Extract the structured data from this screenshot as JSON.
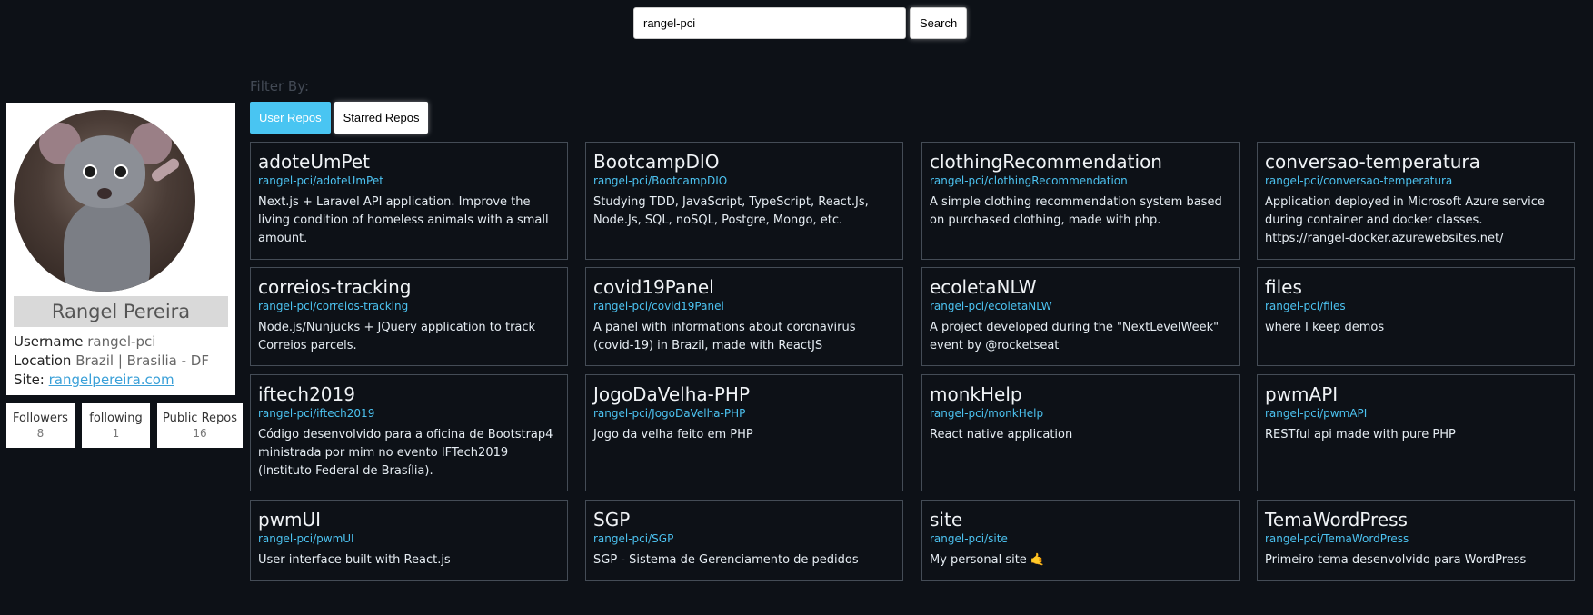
{
  "search": {
    "value": "rangel-pci",
    "button_label": "Search"
  },
  "profile": {
    "name": "Rangel Pereira",
    "username_label": "Username",
    "username": "rangel-pci",
    "location_label": "Location",
    "location": "Brazil | Brasilia - DF",
    "site_label": "Site:",
    "site": "rangelpereira.com"
  },
  "stats": [
    {
      "label": "Followers",
      "value": "8"
    },
    {
      "label": "following",
      "value": "1"
    },
    {
      "label": "Public Repos",
      "value": "16"
    }
  ],
  "filter": {
    "label": "Filter By:",
    "options": [
      "User Repos",
      "Starred Repos"
    ],
    "active": "User Repos"
  },
  "repos": [
    {
      "name": "adoteUmPet",
      "path": "rangel-pci/adoteUmPet",
      "description": "Next.js + Laravel API application. Improve the living condition of homeless animals with a small amount."
    },
    {
      "name": "BootcampDIO",
      "path": "rangel-pci/BootcampDIO",
      "description": "Studying TDD, JavaScript, TypeScript, React.Js, Node.Js, SQL, noSQL, Postgre, Mongo, etc."
    },
    {
      "name": "clothingRecommendation",
      "path": "rangel-pci/clothingRecommendation",
      "description": "A simple clothing recommendation system based on purchased clothing, made with php."
    },
    {
      "name": "conversao-temperatura",
      "path": "rangel-pci/conversao-temperatura",
      "description": "Application deployed in Microsoft Azure service during container and docker classes. https://rangel-docker.azurewebsites.net/"
    },
    {
      "name": "correios-tracking",
      "path": "rangel-pci/correios-tracking",
      "description": "Node.js/Nunjucks + JQuery application to track Correios parcels."
    },
    {
      "name": "covid19Panel",
      "path": "rangel-pci/covid19Panel",
      "description": "A panel with informations about coronavirus (covid-19) in Brazil, made with ReactJS"
    },
    {
      "name": "ecoletaNLW",
      "path": "rangel-pci/ecoletaNLW",
      "description": "A project developed during the \"NextLevelWeek\" event by @rocketseat"
    },
    {
      "name": "files",
      "path": "rangel-pci/files",
      "description": "where I keep demos"
    },
    {
      "name": "iftech2019",
      "path": "rangel-pci/iftech2019",
      "description": "Código desenvolvido para a oficina de Bootstrap4 ministrada por mim no evento IFTech2019 (Instituto Federal de Brasília)."
    },
    {
      "name": "JogoDaVelha-PHP",
      "path": "rangel-pci/JogoDaVelha-PHP",
      "description": "Jogo da velha feito em PHP"
    },
    {
      "name": "monkHelp",
      "path": "rangel-pci/monkHelp",
      "description": "React native application"
    },
    {
      "name": "pwmAPI",
      "path": "rangel-pci/pwmAPI",
      "description": "RESTful api made with pure PHP"
    },
    {
      "name": "pwmUI",
      "path": "rangel-pci/pwmUI",
      "description": "User interface built with React.js"
    },
    {
      "name": "SGP",
      "path": "rangel-pci/SGP",
      "description": "SGP - Sistema de Gerenciamento de pedidos"
    },
    {
      "name": "site",
      "path": "rangel-pci/site",
      "description": "My personal site 🤙"
    },
    {
      "name": "TemaWordPress",
      "path": "rangel-pci/TemaWordPress",
      "description": "Primeiro tema desenvolvido para WordPress"
    }
  ]
}
